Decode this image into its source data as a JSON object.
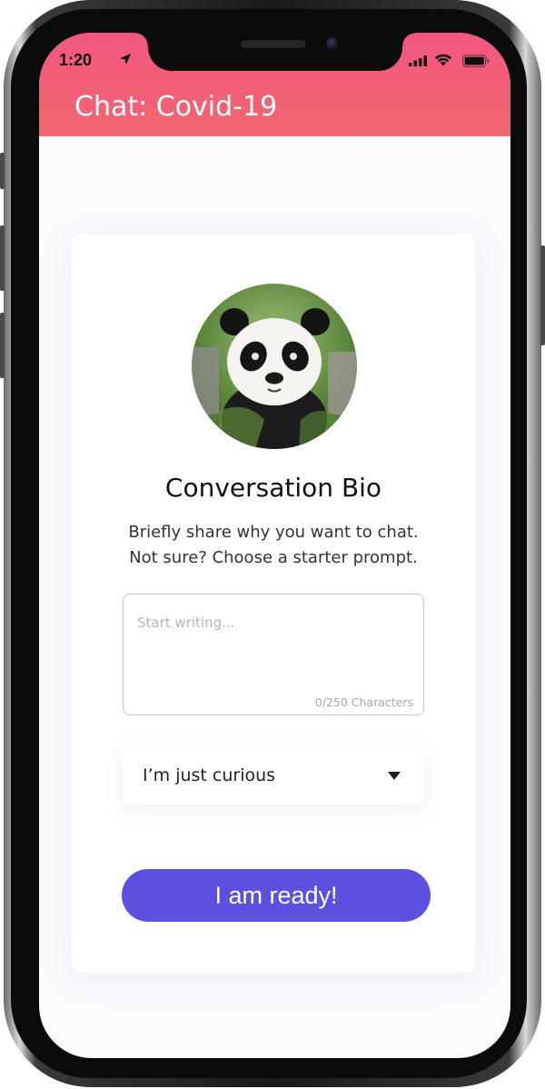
{
  "status_bar": {
    "time": "1:20",
    "icons": [
      "location-arrow-icon",
      "cellular-signal-icon",
      "wifi-icon",
      "battery-icon"
    ]
  },
  "header": {
    "title": "Chat: Covid-19",
    "background_color": "#f1577e"
  },
  "card": {
    "avatar": "panda-avatar",
    "title": "Conversation Bio",
    "subtitle_line1": "Briefly share why you want to chat.",
    "subtitle_line2": "Not sure? Choose a starter prompt.",
    "bio_input": {
      "value": "",
      "placeholder": "Start writing...",
      "counter": "0/250 Characters"
    },
    "prompt_select": {
      "selected": "I’m just curious",
      "icon": "chevron-down-icon"
    },
    "submit_label": "I am ready!",
    "accent_color": "#5c51de"
  }
}
